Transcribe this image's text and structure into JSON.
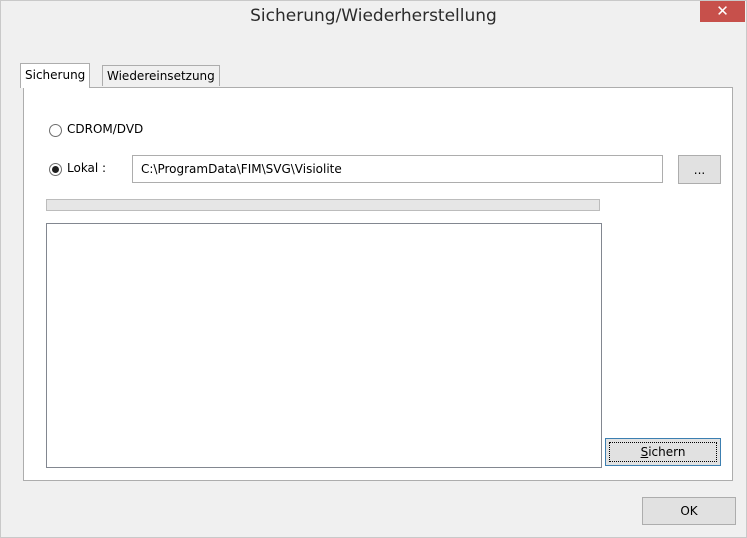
{
  "window": {
    "title": "Sicherung/Wiederherstellung",
    "close_icon": "close-icon",
    "close_glyph": "✕",
    "close_color": "#c7504b"
  },
  "tabs": [
    {
      "label": "Sicherung",
      "active": true
    },
    {
      "label": "Wiedereinsetzung",
      "active": false
    }
  ],
  "source": {
    "cdrom_label": "CDROM/DVD",
    "cdrom_selected": false,
    "local_label": "Lokal :",
    "local_selected": true,
    "path_value": "C:\\ProgramData\\FIM\\SVG\\Visiolite",
    "browse_label": "..."
  },
  "progress": {
    "value": 0
  },
  "actions": {
    "save_label": "Sichern",
    "save_accel": "S",
    "save_rest": "ichern"
  },
  "footer": {
    "ok_label": "OK"
  }
}
